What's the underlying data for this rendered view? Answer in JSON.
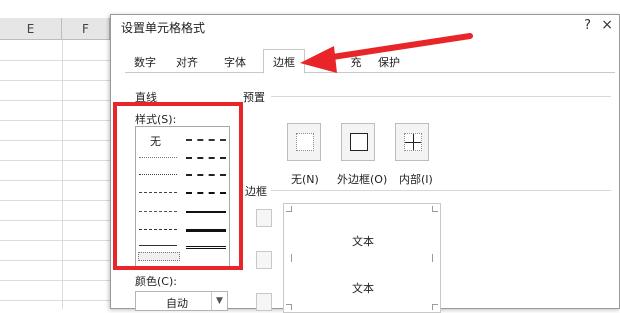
{
  "sheet": {
    "columns": [
      "E",
      "F"
    ]
  },
  "dialog": {
    "title": "设置单元格格式",
    "help": "?",
    "close": "×"
  },
  "tabs": [
    {
      "label": "数字"
    },
    {
      "label": "对齐"
    },
    {
      "label": "字体"
    },
    {
      "label": "边框",
      "active": true
    },
    {
      "label": "充"
    },
    {
      "label": "保护"
    }
  ],
  "line": {
    "group_label": "直线",
    "style_label": "样式(S):",
    "none_label": "无"
  },
  "color": {
    "label": "颜色(C):",
    "value": "自动"
  },
  "presets": {
    "group_label": "预置",
    "items": [
      {
        "label": "无(N)"
      },
      {
        "label": "外边框(O)"
      },
      {
        "label": "内部(I)"
      }
    ]
  },
  "border": {
    "group_label": "边框"
  },
  "preview": {
    "text_top": "文本",
    "text_bottom": "文本"
  },
  "colors": {
    "highlight": "#e8262a",
    "arrow": "#e8262a"
  }
}
